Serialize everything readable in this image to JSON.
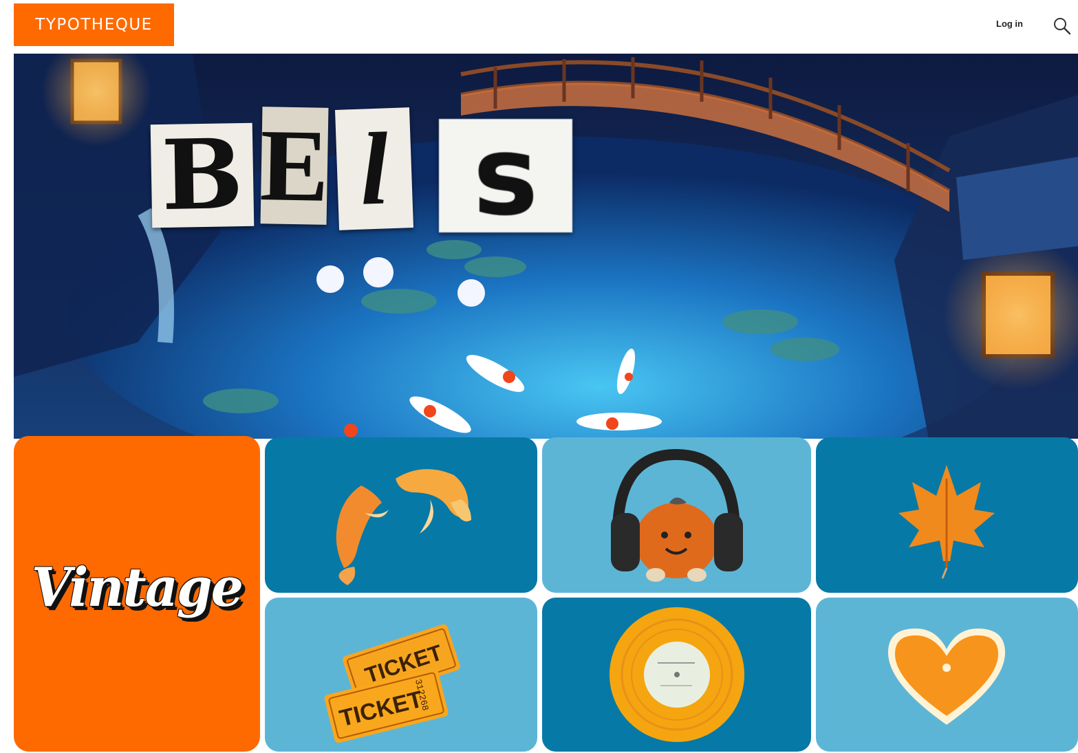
{
  "header": {
    "logo_text": "TYPOTHEQUE",
    "login_label": "Log in",
    "search_icon": "search-icon"
  },
  "hero": {
    "title_letters": [
      "B",
      "E",
      "l",
      "s"
    ]
  },
  "tiles": {
    "vintage_label": "Vintage",
    "ticket_text": "TICKET",
    "ticket_number": "312268"
  },
  "colors": {
    "brand_orange": "#ff6a00",
    "tile_dark_blue": "#0779a6",
    "tile_light_blue": "#5db5d6"
  }
}
